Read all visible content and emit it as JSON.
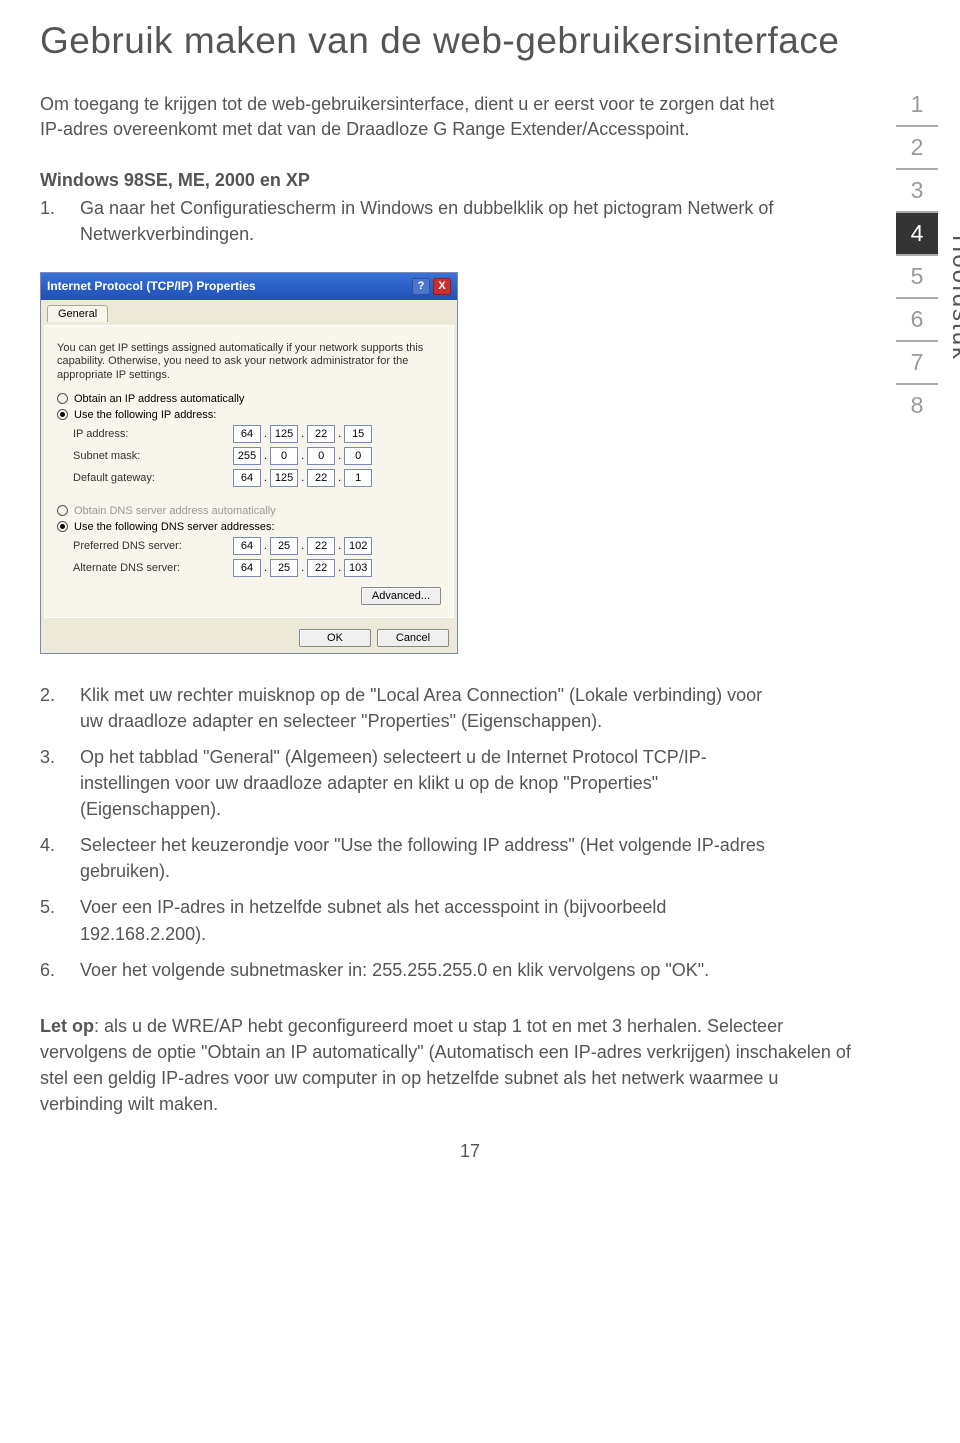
{
  "title": "Gebruik maken van de web-gebruikersinterface",
  "intro": "Om toegang te krijgen tot de web-gebruikersinterface, dient u er eerst voor te zorgen dat het IP-adres overeenkomt met dat van de Draadloze G Range Extender/Accesspoint.",
  "section_a": {
    "heading": "Windows 98SE, ME, 2000 en XP",
    "step1_num": "1.",
    "step1": "Ga naar het Configuratiescherm in Windows en dubbelklik op het pictogram Netwerk of Netwerkverbindingen."
  },
  "steps_b": [
    {
      "num": "2.",
      "text": "Klik met uw rechter muisknop op de \"Local Area Connection\" (Lokale verbinding) voor uw draadloze adapter en selecteer \"Properties\" (Eigenschappen)."
    },
    {
      "num": "3.",
      "text": "Op het tabblad \"General\" (Algemeen) selecteert u de Internet Protocol TCP/IP-instellingen voor uw draadloze adapter en klikt u op de knop \"Properties\" (Eigenschappen)."
    },
    {
      "num": "4.",
      "text": "Selecteer het keuzerondje voor \"Use the following IP address\" (Het volgende IP-adres gebruiken)."
    },
    {
      "num": "5.",
      "text": "Voer een IP-adres in hetzelfde subnet als het accesspoint in (bijvoorbeeld 192.168.2.200)."
    },
    {
      "num": "6.",
      "text": "Voer het volgende subnetmasker in: 255.255.255.0 en klik vervolgens op \"OK\"."
    }
  ],
  "note_label": "Let op",
  "note_text": ": als u de WRE/AP hebt geconfigureerd moet u stap 1 tot en met 3 herhalen. Selecteer vervolgens de optie \"Obtain an IP automatically\" (Automatisch een IP-adres verkrijgen) inschakelen of stel een geldig IP-adres voor uw computer in op hetzelfde subnet als het netwerk waarmee u verbinding wilt maken.",
  "page_number": "17",
  "sidenav": {
    "items": [
      "1",
      "2",
      "3",
      "4",
      "5",
      "6",
      "7",
      "8"
    ],
    "active_index": 3,
    "chapter_label": "Hoofdstuk"
  },
  "dialog": {
    "title": "Internet Protocol (TCP/IP) Properties",
    "help_btn": "?",
    "close_btn": "X",
    "tab": "General",
    "desc": "You can get IP settings assigned automatically if your network supports this capability. Otherwise, you need to ask your network administrator for the appropriate IP settings.",
    "radio_obtain_ip": "Obtain an IP address automatically",
    "radio_use_ip": "Use the following IP address:",
    "lbl_ip": "IP address:",
    "lbl_subnet": "Subnet mask:",
    "lbl_gateway": "Default gateway:",
    "radio_obtain_dns": "Obtain DNS server address automatically",
    "radio_use_dns": "Use the following DNS server addresses:",
    "lbl_pref_dns": "Preferred DNS server:",
    "lbl_alt_dns": "Alternate DNS server:",
    "ip": [
      "64",
      "125",
      "22",
      "15"
    ],
    "subnet": [
      "255",
      "0",
      "0",
      "0"
    ],
    "gateway": [
      "64",
      "125",
      "22",
      "1"
    ],
    "pref_dns": [
      "64",
      "25",
      "22",
      "102"
    ],
    "alt_dns": [
      "64",
      "25",
      "22",
      "103"
    ],
    "btn_advanced": "Advanced...",
    "btn_ok": "OK",
    "btn_cancel": "Cancel"
  }
}
